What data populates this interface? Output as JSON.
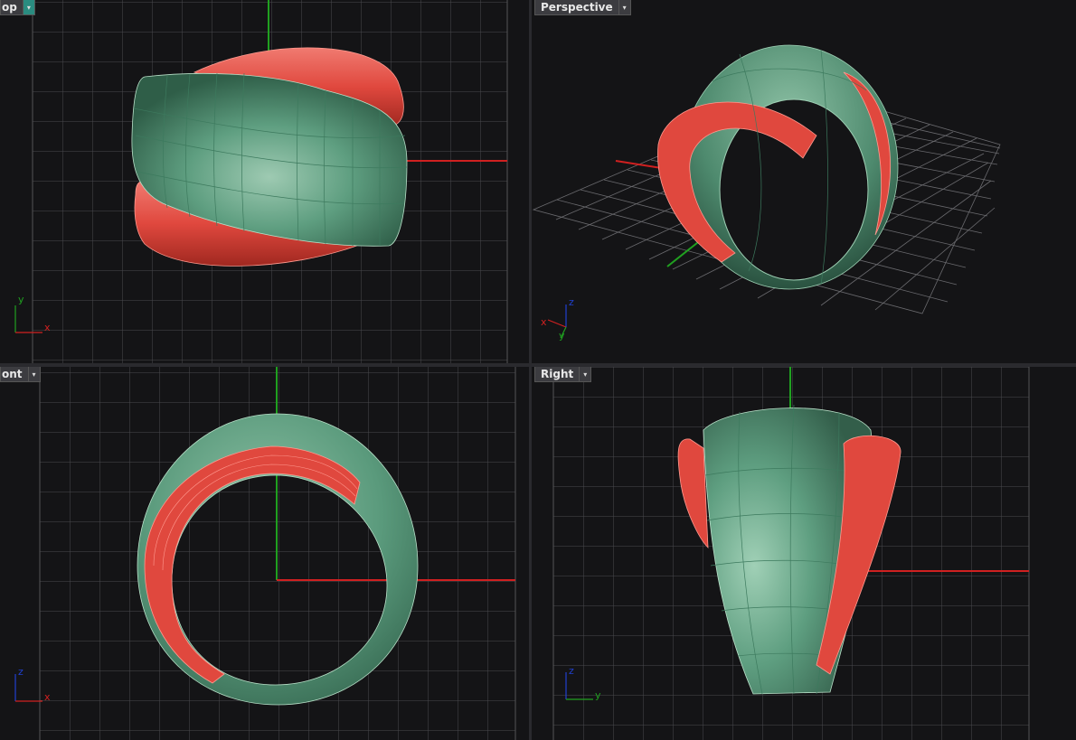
{
  "viewports": {
    "top": {
      "label": "op"
    },
    "persp": {
      "label": "Perspective"
    },
    "front": {
      "label": "ont"
    },
    "right": {
      "label": "Right"
    }
  },
  "dropdown_glyph": "▾",
  "axis_labels": {
    "top": {
      "a": "y",
      "b": "x"
    },
    "persp": {
      "a": "z",
      "b": "x",
      "c": "y"
    },
    "front": {
      "a": "z",
      "b": "x"
    },
    "right": {
      "a": "z",
      "b": "y"
    }
  },
  "colors": {
    "background": "#141416",
    "grid": "#4a4a4e",
    "ring_body": "#5e9e80",
    "ring_accent": "#e0483e",
    "axis_x": "#d02020",
    "axis_y": "#20a020",
    "axis_z": "#2040d0",
    "active_tab": "#2a8c80"
  },
  "icons": [
    "dropdown-arrow-icon",
    "axis-triad-icon"
  ]
}
